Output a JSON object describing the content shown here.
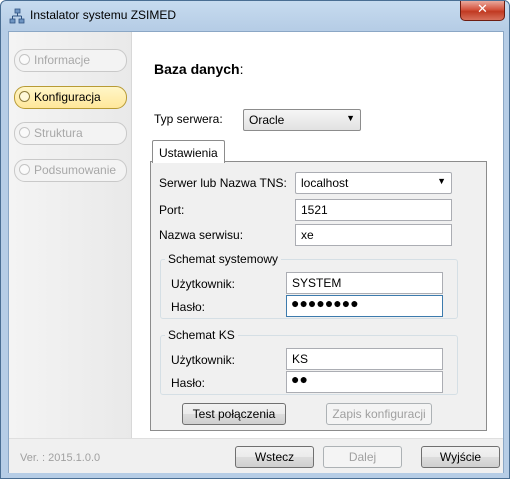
{
  "window": {
    "title": "Instalator systemu ZSIMED",
    "close_label": "✕"
  },
  "sidebar": {
    "items": [
      {
        "label": "Informacje",
        "active": false
      },
      {
        "label": "Konfiguracja",
        "active": true
      },
      {
        "label": "Struktura",
        "active": false
      },
      {
        "label": "Podsumowanie",
        "active": false
      }
    ]
  },
  "main": {
    "heading": "Baza danych",
    "heading_colon": ":",
    "server_type_label": "Typ serwera:",
    "server_type_value": "Oracle",
    "tab_label": "Ustawienia",
    "settings": {
      "tns_label": "Serwer lub Nazwa TNS:",
      "tns_value": "localhost",
      "port_label": "Port:",
      "port_value": "1521",
      "service_label": "Nazwa serwisu:",
      "service_value": "xe",
      "system_schema": {
        "title": "Schemat systemowy",
        "user_label": "Użytkownik:",
        "user_value": "SYSTEM",
        "password_label": "Hasło:",
        "password_mask": "●●●●●●●●"
      },
      "ks_schema": {
        "title": "Schemat KS",
        "user_label": "Użytkownik:",
        "user_value": "KS",
        "password_label": "Hasło:",
        "password_mask": "●●"
      },
      "test_button": "Test połączenia",
      "save_button": "Zapis konfiguracji"
    }
  },
  "footer": {
    "version": "Ver. : 2015.1.0.0",
    "back_button": "Wstecz",
    "next_button": "Dalej",
    "exit_button": "Wyjście"
  },
  "icons": {
    "title": "network-tree-icon",
    "dropdown": "chevron-down-icon"
  }
}
